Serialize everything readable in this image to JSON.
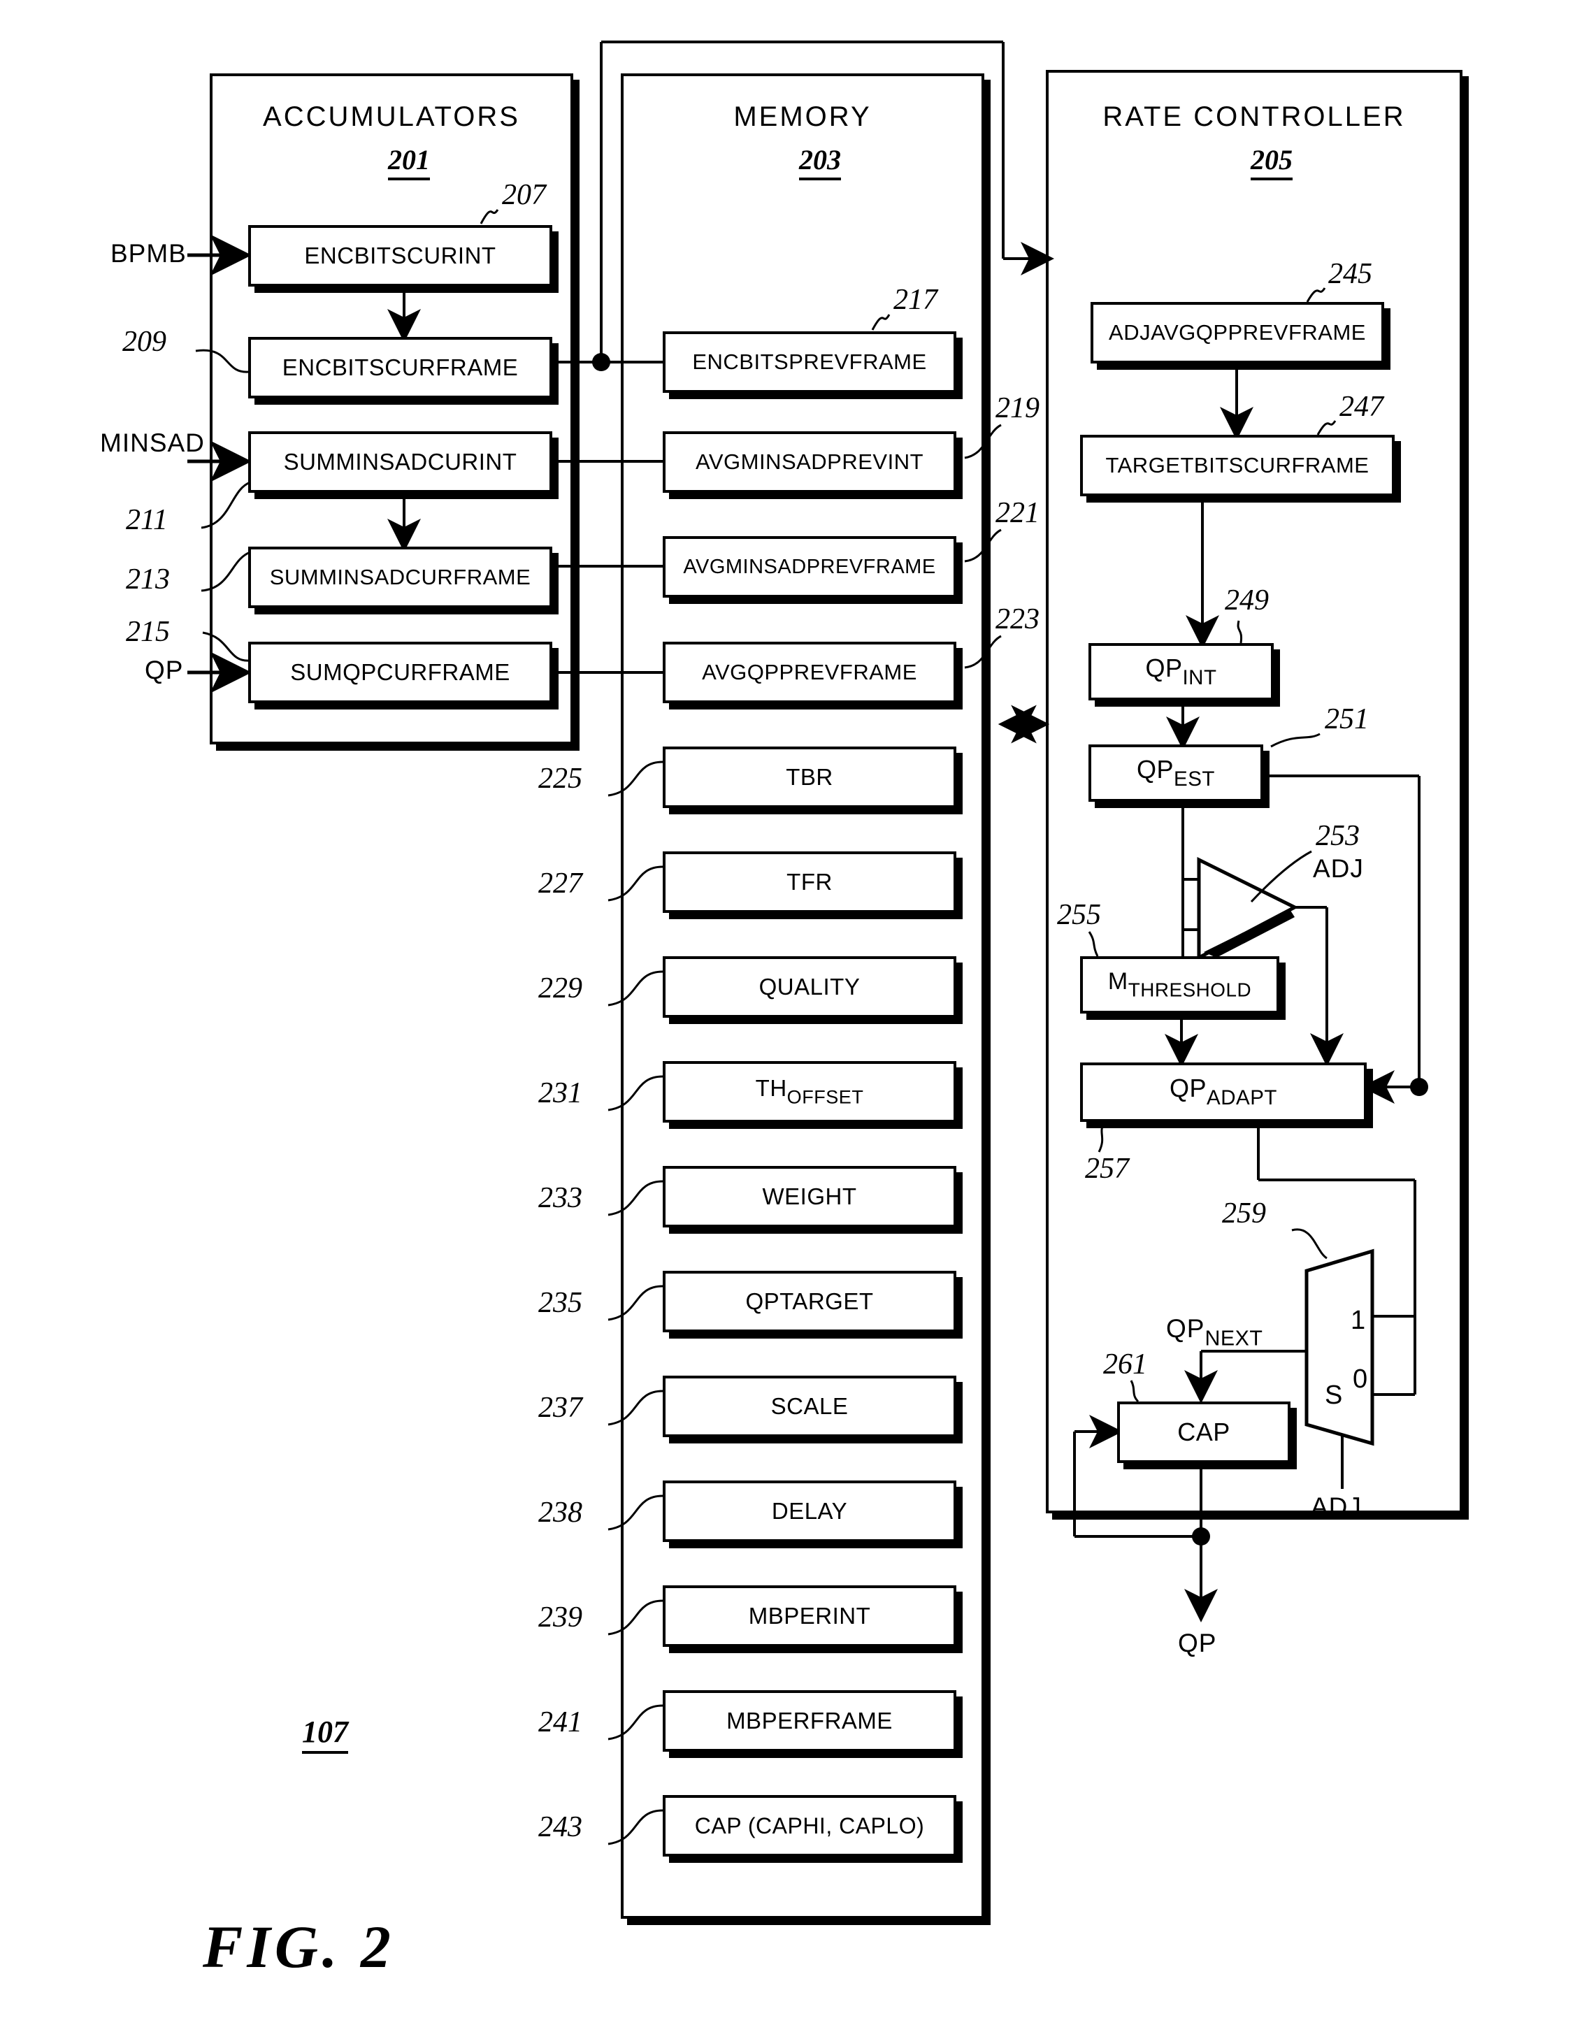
{
  "figure": {
    "label": "FIG. 2",
    "system_ref": "107"
  },
  "panels": [
    {
      "id": "accumulators",
      "title": "ACCUMULATORS",
      "num": "201"
    },
    {
      "id": "memory",
      "title": "MEMORY",
      "num": "203"
    },
    {
      "id": "rate",
      "title": "RATE CONTROLLER",
      "num": "205"
    }
  ],
  "signals": {
    "bpmb": "BPMB",
    "minsad": "MINSAD",
    "qp_in": "QP",
    "qp_out": "QP",
    "adj_amp": "ADJ",
    "adj_mux": "ADJ",
    "qp_next": "QP",
    "qp_next_sub": "NEXT",
    "mux_in1": "1",
    "mux_in0": "0",
    "mux_sel": "S"
  },
  "accumulators": {
    "blocks": [
      {
        "ref": "207",
        "label": "ENCBITSCURINT"
      },
      {
        "ref": "209",
        "label": "ENCBITSCURFRAME"
      },
      {
        "ref": "211",
        "label": "SUMMINSADCURINT"
      },
      {
        "ref": "213",
        "label": "SUMMINSADCURFRAME"
      },
      {
        "ref": "215",
        "label": "SUMQPCURFRAME"
      }
    ]
  },
  "memory": {
    "blocks": [
      {
        "ref": "217",
        "label": "ENCBITSPREVFRAME"
      },
      {
        "ref": "219",
        "label": "AVGMINSADPREVINT"
      },
      {
        "ref": "221",
        "label": "AVGMINSADPREVFRAME"
      },
      {
        "ref": "223",
        "label": "AVGQPPREVFRAME"
      },
      {
        "ref": "225",
        "label": "TBR"
      },
      {
        "ref": "227",
        "label": "TFR"
      },
      {
        "ref": "229",
        "label": "QUALITY"
      },
      {
        "ref": "231",
        "label": "TH",
        "sub": "OFFSET"
      },
      {
        "ref": "233",
        "label": "WEIGHT"
      },
      {
        "ref": "235",
        "label": "QPTARGET"
      },
      {
        "ref": "237",
        "label": "SCALE"
      },
      {
        "ref": "238",
        "label": "DELAY"
      },
      {
        "ref": "239",
        "label": "MBPERINT"
      },
      {
        "ref": "241",
        "label": "MBPERFRAME"
      },
      {
        "ref": "243",
        "label": "CAP (CAPHI, CAPLO)"
      }
    ]
  },
  "rate_controller": {
    "blocks": [
      {
        "ref": "245",
        "label": "ADJAVGQPPREVFRAME"
      },
      {
        "ref": "247",
        "label": "TARGETBITSCURFRAME"
      },
      {
        "ref": "249",
        "label": "QP",
        "sub": "INT"
      },
      {
        "ref": "251",
        "label": "QP",
        "sub": "EST"
      },
      {
        "ref": "253",
        "label": "ADJ",
        "kind": "amplifier"
      },
      {
        "ref": "255",
        "label": "M",
        "sub": "THRESHOLD"
      },
      {
        "ref": "257",
        "label": "QP",
        "sub": "ADAPT"
      },
      {
        "ref": "259",
        "label": "",
        "kind": "mux"
      },
      {
        "ref": "261",
        "label": "CAP"
      }
    ]
  },
  "colors": {
    "stroke": "#000000",
    "background": "#ffffff"
  }
}
